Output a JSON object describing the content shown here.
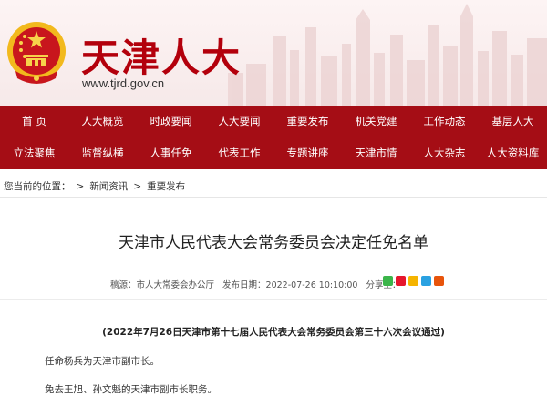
{
  "site": {
    "title": "天津人大",
    "url": "www.tjrd.gov.cn"
  },
  "nav": {
    "row1": [
      "首 页",
      "人大概览",
      "时政要闻",
      "人大要闻",
      "重要发布",
      "机关党建",
      "工作动态",
      "基层人大"
    ],
    "row2": [
      "立法聚焦",
      "监督纵横",
      "人事任免",
      "代表工作",
      "专题讲座",
      "天津市情",
      "人大杂志",
      "人大资料库"
    ]
  },
  "breadcrumb": {
    "prefix": "您当前的位置：",
    "items": [
      "新闻资讯",
      "重要发布"
    ],
    "separator": ">"
  },
  "article": {
    "title": "天津市人民代表大会常务委员会决定任免名单",
    "source": "稿源：市人大常委会办公厅",
    "published": "发布日期：2022-07-26 10:10:00",
    "share_label": "分享至：",
    "session_note": "(2022年7月26日天津市第十七届人民代表大会常务委员会第三十六次会议通过)",
    "paragraphs": [
      "任命杨兵为天津市副市长。",
      "免去王旭、孙文魁的天津市副市长职务。"
    ]
  },
  "share_icons": [
    {
      "name": "wechat-icon",
      "color": "#3bb54a"
    },
    {
      "name": "weibo-icon",
      "color": "#e6162d"
    },
    {
      "name": "qzone-icon",
      "color": "#f5b400"
    },
    {
      "name": "tencent-weibo-icon",
      "color": "#2aa1e1"
    },
    {
      "name": "renren-icon",
      "color": "#e8540b"
    }
  ],
  "colors": {
    "brand_red": "#a50d15",
    "title_red": "#b3000c"
  }
}
